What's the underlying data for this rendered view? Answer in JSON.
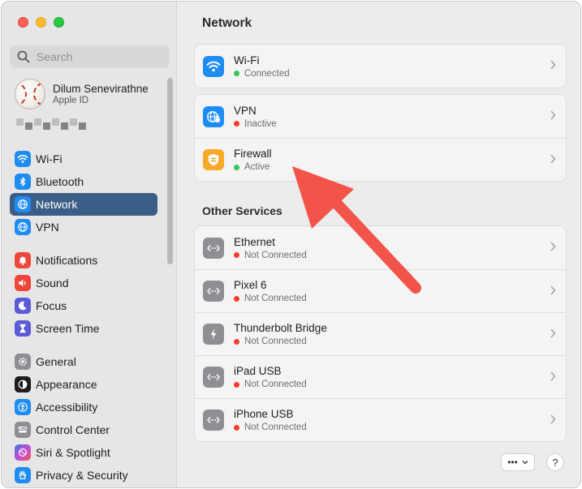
{
  "window": {
    "traffic_lights": [
      "close",
      "minimize",
      "zoom"
    ]
  },
  "sidebar": {
    "search_placeholder": "Search",
    "profile": {
      "name": "Dilum Senevirathne",
      "subtitle": "Apple ID"
    },
    "groups": [
      [
        {
          "label": "Wi-Fi",
          "icon": "wifi-icon",
          "color": "#1f8cf2"
        },
        {
          "label": "Bluetooth",
          "icon": "bluetooth-icon",
          "color": "#1f8cf2"
        },
        {
          "label": "Network",
          "icon": "globe-icon",
          "color": "#1f8cf2",
          "selected": true
        },
        {
          "label": "VPN",
          "icon": "globe-icon",
          "color": "#1f8cf2"
        }
      ],
      [
        {
          "label": "Notifications",
          "icon": "bell-icon",
          "color": "#f0453a"
        },
        {
          "label": "Sound",
          "icon": "speaker-icon",
          "color": "#f0453a"
        },
        {
          "label": "Focus",
          "icon": "moon-icon",
          "color": "#5b5bd6"
        },
        {
          "label": "Screen Time",
          "icon": "hourglass-icon",
          "color": "#5b5bd6"
        }
      ],
      [
        {
          "label": "General",
          "icon": "gear-icon",
          "color": "#8e8e93"
        },
        {
          "label": "Appearance",
          "icon": "appearance-icon",
          "color": "#1d1d1f"
        },
        {
          "label": "Accessibility",
          "icon": "accessibility-icon",
          "color": "#1f8cf2"
        },
        {
          "label": "Control Center",
          "icon": "control-center-icon",
          "color": "#8e8e93"
        },
        {
          "label": "Siri & Spotlight",
          "icon": "siri-icon",
          "color": "#7a4bd8"
        },
        {
          "label": "Privacy & Security",
          "icon": "hand-icon",
          "color": "#1f8cf2"
        }
      ]
    ]
  },
  "main": {
    "title": "Network",
    "cards": [
      [
        {
          "title": "Wi-Fi",
          "status": "Connected",
          "status_color": "#34c759",
          "icon": "wifi-icon",
          "icon_bg": "#1f8cf2"
        }
      ],
      [
        {
          "title": "VPN",
          "status": "Inactive",
          "status_color": "#ff3b30",
          "icon": "globe-lock-icon",
          "icon_bg": "#1f8cf2"
        },
        {
          "title": "Firewall",
          "status": "Active",
          "status_color": "#34c759",
          "icon": "firewall-icon",
          "icon_bg": "#f7a928"
        }
      ]
    ],
    "section_title": "Other Services",
    "services": [
      {
        "title": "Ethernet",
        "status": "Not Connected",
        "status_color": "#ff3b30",
        "icon": "ethernet-icon",
        "icon_bg": "#8e8e93"
      },
      {
        "title": "Pixel 6",
        "status": "Not Connected",
        "status_color": "#ff3b30",
        "icon": "ethernet-icon",
        "icon_bg": "#8e8e93"
      },
      {
        "title": "Thunderbolt Bridge",
        "status": "Not Connected",
        "status_color": "#ff3b30",
        "icon": "thunderbolt-icon",
        "icon_bg": "#8e8e93"
      },
      {
        "title": "iPad USB",
        "status": "Not Connected",
        "status_color": "#ff3b30",
        "icon": "ethernet-icon",
        "icon_bg": "#8e8e93"
      },
      {
        "title": "iPhone USB",
        "status": "Not Connected",
        "status_color": "#ff3b30",
        "icon": "ethernet-icon",
        "icon_bg": "#8e8e93"
      }
    ],
    "more_button": "•••",
    "help_button": "?"
  },
  "annotation": {
    "arrow_color": "#f2544a"
  }
}
